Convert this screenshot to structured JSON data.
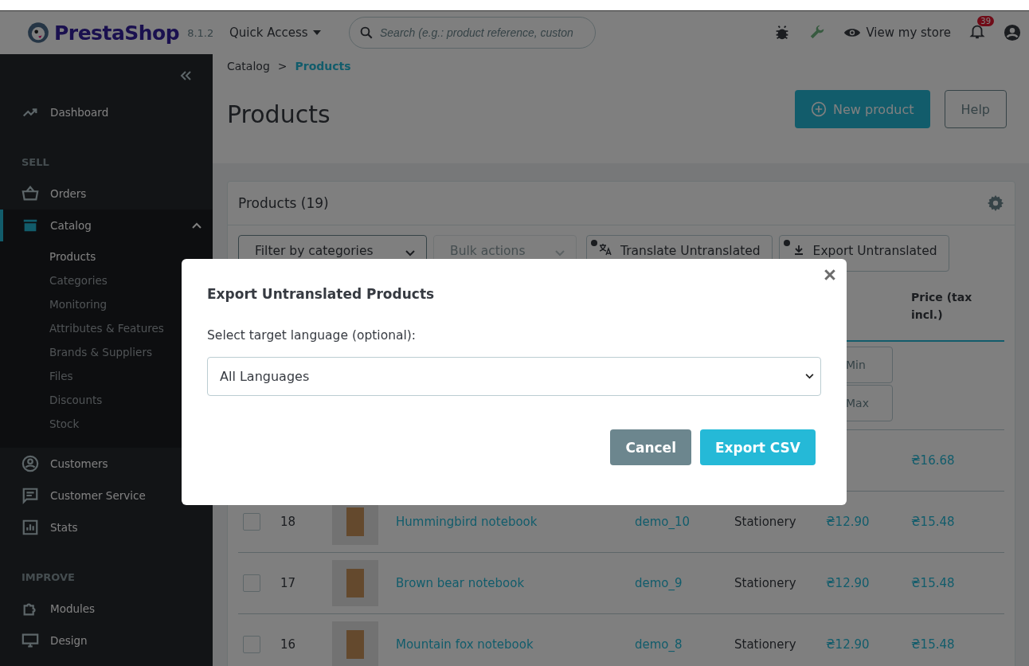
{
  "header": {
    "logo": "PrestaShop",
    "version": "8.1.2",
    "quick_access": "Quick Access",
    "search": {
      "placeholder": "Search (e.g.: product reference, custon"
    },
    "view_store": "View my store",
    "notifications": "39"
  },
  "sidebar": {
    "items": [
      {
        "kind": "link",
        "label": "Dashboard"
      },
      {
        "kind": "section",
        "label": "SELL"
      },
      {
        "kind": "link",
        "label": "Orders"
      },
      {
        "kind": "group",
        "label": "Catalog",
        "expanded": true,
        "selected": true,
        "children": [
          {
            "label": "Products",
            "selected": true
          },
          {
            "label": "Categories",
            "selected": false
          },
          {
            "label": "Monitoring",
            "selected": false
          },
          {
            "label": "Attributes & Features",
            "selected": false
          },
          {
            "label": "Brands & Suppliers",
            "selected": false
          },
          {
            "label": "Files",
            "selected": false
          },
          {
            "label": "Discounts",
            "selected": false
          },
          {
            "label": "Stock",
            "selected": false
          }
        ]
      },
      {
        "kind": "link",
        "label": "Customers"
      },
      {
        "kind": "link",
        "label": "Customer Service"
      },
      {
        "kind": "link",
        "label": "Stats"
      },
      {
        "kind": "section",
        "label": "IMPROVE"
      },
      {
        "kind": "link",
        "label": "Modules"
      },
      {
        "kind": "link",
        "label": "Design"
      }
    ]
  },
  "breadcrumb_separator": ">",
  "breadcrumb": [
    {
      "label": "Catalog",
      "current": false
    },
    {
      "label": "Products",
      "current": true
    }
  ],
  "page_title": "Products",
  "actions": [
    {
      "label": "New product",
      "kind": "primary"
    },
    {
      "label": "Help",
      "kind": "outline"
    }
  ],
  "card": {
    "title": "Products (19)",
    "toolbar": [
      {
        "label": "Filter by categories",
        "kind": "dropdown",
        "disabled": false
      },
      {
        "label": "Bulk actions",
        "kind": "dropdown",
        "disabled": true
      },
      {
        "label": "Translate Untranslated",
        "kind": "translate",
        "disabled": false
      },
      {
        "label": "Export Untranslated",
        "kind": "export",
        "disabled": false
      }
    ],
    "table": {
      "header": "Price (tax incl.)",
      "filters": [
        {
          "placeholder": "Min"
        },
        {
          "placeholder": "Max"
        }
      ],
      "rows": [
        {
          "price_incl": "₴16.68"
        },
        {
          "checked": false,
          "id": "18",
          "name": "Hummingbird notebook",
          "reference": "demo_10",
          "category": "Stationery",
          "price_excl": "₴12.90",
          "price_incl": "₴15.48"
        },
        {
          "checked": false,
          "id": "17",
          "name": "Brown bear notebook",
          "reference": "demo_9",
          "category": "Stationery",
          "price_excl": "₴12.90",
          "price_incl": "₴15.48"
        },
        {
          "checked": false,
          "id": "16",
          "name": "Mountain fox notebook",
          "reference": "demo_8",
          "category": "Stationery",
          "price_excl": "₴12.90",
          "price_incl": "₴15.48"
        }
      ]
    }
  },
  "modal": {
    "title": "Export Untranslated Products",
    "label": "Select target language (optional):",
    "select": {
      "value": "All Languages"
    },
    "buttons": [
      {
        "label": "Cancel",
        "kind": "secondary"
      },
      {
        "label": "Export CSV",
        "kind": "primary"
      }
    ]
  }
}
